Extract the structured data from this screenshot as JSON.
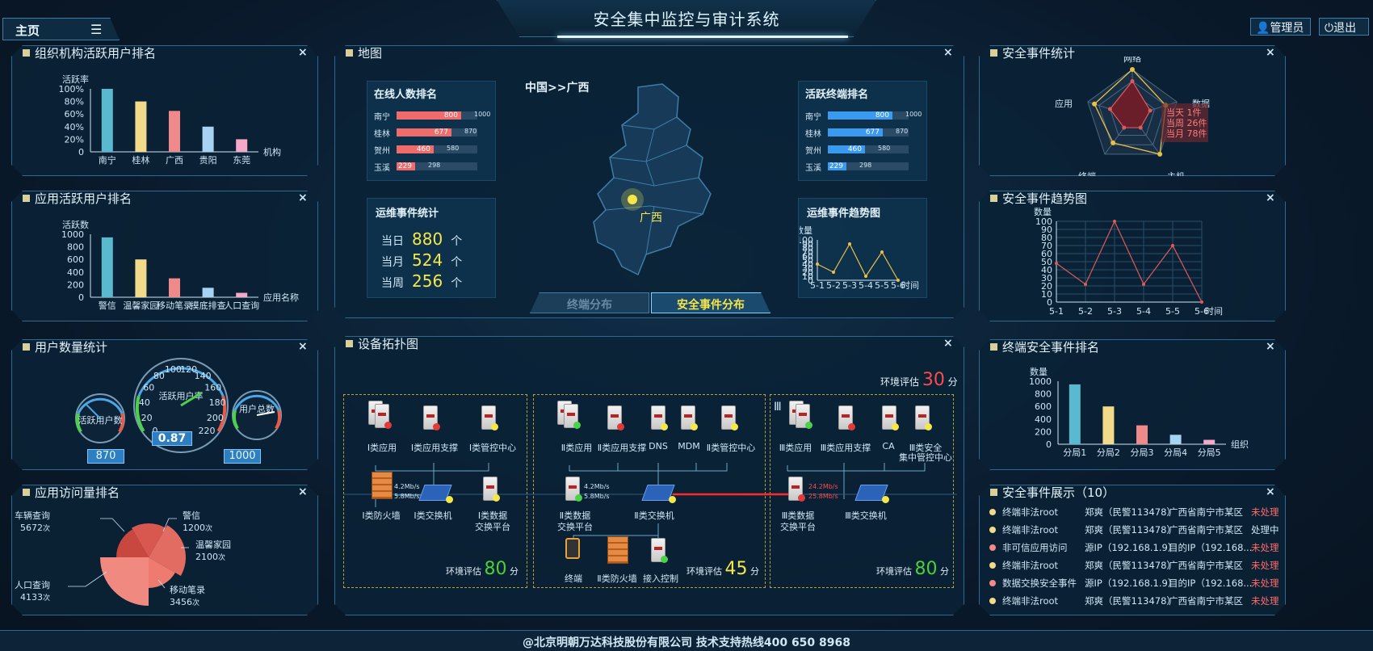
{
  "app_title": "安全集中监控与审计系统",
  "home_tab": "主页",
  "admin_label": "管理员",
  "logout_label": "退出",
  "footer": "@北京明朝万达科技股份有限公司 技术支持热线400 650 8968",
  "panels": {
    "org_rank": "组织机构活跃用户排名",
    "app_rank": "应用活跃用户排名",
    "user_count": "用户数量统计",
    "app_visit": "应用访问量排名",
    "map": "地图",
    "topology": "设备拓扑图",
    "sec_stats": "安全事件统计",
    "sec_trend": "安全事件趋势图",
    "term_rank": "终端安全事件排名",
    "sec_show": "安全事件展示（10）"
  },
  "close_icon": "×",
  "chart_data": [
    {
      "type": "bar",
      "ylabel": "活跃率",
      "xlabel": "机构",
      "categories": [
        "南宁",
        "桂林",
        "广西",
        "贵阳",
        "东莞"
      ],
      "values": [
        100,
        80,
        65,
        40,
        20
      ],
      "yticks": [
        "100%",
        "80%",
        "60%",
        "40%",
        "20%",
        "0"
      ],
      "colors": [
        "#5ab9cf",
        "#f2da8b",
        "#f08a8a",
        "#a8d2f2",
        "#f5a9c8"
      ]
    },
    {
      "type": "bar",
      "ylabel": "活跃数",
      "xlabel": "应用名称",
      "categories": [
        "警信",
        "温馨家园",
        "移动笔录",
        "摸底排查",
        "人口查询"
      ],
      "values": [
        950,
        600,
        300,
        150,
        70
      ],
      "yticks": [
        "1000",
        "800",
        "600",
        "400",
        "200",
        "0"
      ],
      "colors": [
        "#5ab9cf",
        "#f2da8b",
        "#f08a8a",
        "#a8d2f2",
        "#f5a9c8"
      ]
    },
    {
      "type": "pie",
      "title": "",
      "slices": [
        {
          "label": "车辆查询",
          "value": "5672",
          "unit": "次"
        },
        {
          "label": "警信",
          "value": "1200",
          "unit": "次"
        },
        {
          "label": "温馨家园",
          "value": "2100",
          "unit": "次"
        },
        {
          "label": "移动笔录",
          "value": "3456",
          "unit": "次"
        },
        {
          "label": "人口查询",
          "value": "4133",
          "unit": "次"
        }
      ]
    },
    {
      "type": "line",
      "title": "运维事件趋势图",
      "ylabel": "数量",
      "xlabel": "时间",
      "categories": [
        "5-1",
        "5-2",
        "5-3",
        "5-4",
        "5-5",
        "5-6"
      ],
      "values": [
        40,
        20,
        90,
        10,
        70,
        0
      ],
      "ylim": [
        0,
        100
      ]
    },
    {
      "type": "line",
      "title": "安全事件趋势图",
      "ylabel": "数量",
      "xlabel": "时间",
      "categories": [
        "5-1",
        "5-2",
        "5-3",
        "5-4",
        "5-5",
        "5-6"
      ],
      "values": [
        48,
        22,
        100,
        22,
        70,
        0
      ],
      "ylim": [
        0,
        100
      ]
    },
    {
      "type": "bar",
      "ylabel": "数量",
      "xlabel": "组织",
      "categories": [
        "分局1",
        "分局2",
        "分局3",
        "分局4",
        "分局5"
      ],
      "values": [
        950,
        600,
        300,
        150,
        70
      ],
      "yticks": [
        "1000",
        "800",
        "600",
        "400",
        "200",
        "0"
      ],
      "colors": [
        "#5ab9cf",
        "#f2da8b",
        "#f08a8a",
        "#a8d2f2",
        "#f5a9c8"
      ]
    },
    {
      "type": "radar",
      "axes": [
        "网络",
        "数据",
        "主机",
        "终端",
        "应用"
      ],
      "legend": [
        "当天 1件",
        "当周 26件",
        "当月 78件"
      ]
    }
  ],
  "gauges": {
    "left_label": "活跃用户数",
    "left_value": "870",
    "center_label": "活跃用户率",
    "center_value": "0.87",
    "right_label": "用户总数",
    "right_value": "1000",
    "ticks": [
      "0",
      "20",
      "40",
      "60",
      "80",
      "100",
      "120",
      "140",
      "160",
      "180",
      "200",
      "220"
    ]
  },
  "map": {
    "breadcrumb": "中国>>广西",
    "city": "广西",
    "online_title": "在线人数排名",
    "terminal_title": "活跃终端排名",
    "online": [
      {
        "name": "南宁",
        "value": "800",
        "max": "1000"
      },
      {
        "name": "桂林",
        "value": "677",
        "max": "870"
      },
      {
        "name": "贺州",
        "value": "460",
        "max": "580"
      },
      {
        "name": "玉溪",
        "value": "229",
        "max": "298"
      }
    ],
    "terminal": [
      {
        "name": "南宁",
        "value": "800",
        "max": "1000"
      },
      {
        "name": "桂林",
        "value": "677",
        "max": "870"
      },
      {
        "name": "贺州",
        "value": "460",
        "max": "580"
      },
      {
        "name": "玉溪",
        "value": "229",
        "max": "298"
      }
    ],
    "ops_title": "运维事件统计",
    "ops": [
      {
        "label": "当日",
        "value": "880",
        "unit": "个"
      },
      {
        "label": "当月",
        "value": "524",
        "unit": "个"
      },
      {
        "label": "当周",
        "value": "256",
        "unit": "个"
      }
    ],
    "trend_title": "运维事件趋势图",
    "tab1": "终端分布",
    "tab2": "安全事件分布"
  },
  "topology": {
    "env1": {
      "label": "环境评估",
      "score": "30",
      "unit": "分"
    },
    "env2": {
      "label": "环境评估",
      "score": "80",
      "unit": "分"
    },
    "env3": {
      "label": "环境评估",
      "score": "45",
      "unit": "分"
    },
    "env4": {
      "label": "环境评估",
      "score": "80",
      "unit": "分"
    },
    "z1": [
      "Ⅰ类应用",
      "Ⅰ类应用支撑",
      "Ⅰ类管控中心",
      "Ⅰ类防火墙",
      "Ⅰ类交换机",
      "Ⅰ类数据",
      "交换平台"
    ],
    "z2": [
      "Ⅱ类应用",
      "Ⅱ类应用支撑",
      "DNS",
      "MDM",
      "Ⅱ类管控中心",
      "Ⅱ类数据",
      "交换平台",
      "Ⅱ类交换机",
      "终端",
      "Ⅱ类防火墙",
      "接入控制"
    ],
    "z3": [
      "Ⅲ",
      "Ⅲ类应用",
      "Ⅲ类应用支撑",
      "CA",
      "Ⅲ类安全",
      "集中管控中心",
      "Ⅲ类数据",
      "交换平台",
      "Ⅲ类交换机"
    ],
    "rate1a": "4.2Mb/s",
    "rate1b": "5.8Mb/s",
    "rate2a": "4.2Mb/s",
    "rate2b": "5.8Mb/s",
    "rate3a": "24.2Mb/s",
    "rate3b": "25.8Mb/s"
  },
  "events": [
    {
      "type": "终端非法root",
      "who": "郑爽（民警113478）",
      "where": "广西省南宁市某区",
      "status": "未处理",
      "dot": "#f2da8b",
      "scolor": "#ff6b6b"
    },
    {
      "type": "终端非法root",
      "who": "郑爽（民警113478）",
      "where": "广西省南宁市某区",
      "status": "处理中",
      "dot": "#f2da8b",
      "scolor": "#cfe6f5"
    },
    {
      "type": "非可信应用访问",
      "who": "源IP（192.168.1.9）",
      "where": "目的IP（192.168...",
      "status": "未处理",
      "dot": "#f08a8a",
      "scolor": "#ff6b6b"
    },
    {
      "type": "终端非法root",
      "who": "郑爽（民警113478）",
      "where": "广西省南宁市某区",
      "status": "未处理",
      "dot": "#f2da8b",
      "scolor": "#ff6b6b"
    },
    {
      "type": "数据交换安全事件",
      "who": "源IP（192.168.1.9）",
      "where": "目的IP（192.168...",
      "status": "未处理",
      "dot": "#f08a8a",
      "scolor": "#ff6b6b"
    },
    {
      "type": "终端非法root",
      "who": "郑爽（民警113478）",
      "where": "广西省南宁市某区",
      "status": "未处理",
      "dot": "#f2da8b",
      "scolor": "#ff6b6b"
    }
  ]
}
